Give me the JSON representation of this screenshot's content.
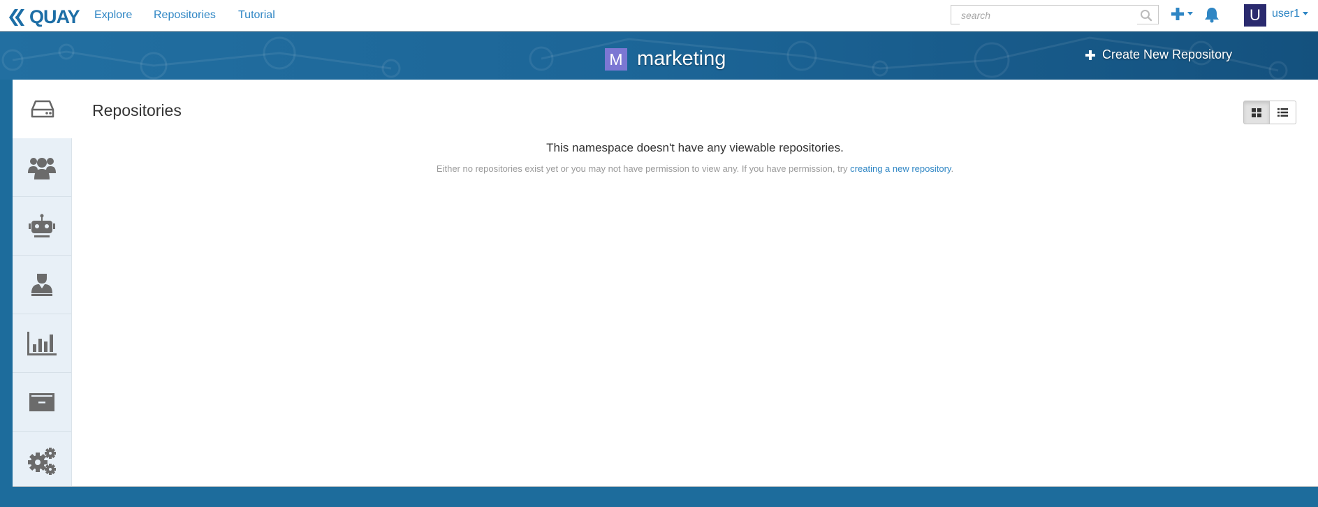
{
  "navbar": {
    "logo_text": "QUAY",
    "links": [
      "Explore",
      "Repositories",
      "Tutorial"
    ],
    "search_placeholder": "search",
    "avatar_letter": "U",
    "username": "user1"
  },
  "banner": {
    "namespace_avatar_letter": "M",
    "namespace_name": "marketing",
    "create_repo_label": "Create New Repository"
  },
  "sidebar": {
    "tabs": [
      {
        "icon": "hdd-icon"
      },
      {
        "icon": "users-icon"
      },
      {
        "icon": "robot-icon"
      },
      {
        "icon": "user-admin-icon"
      },
      {
        "icon": "bar-chart-icon"
      },
      {
        "icon": "archive-icon"
      },
      {
        "icon": "gears-icon"
      }
    ]
  },
  "main": {
    "section_title": "Repositories",
    "empty_title": "This namespace doesn't have any viewable repositories.",
    "empty_text_before": "Either no repositories exist yet or you may not have permission to view any. If you have permission, try ",
    "empty_link": "creating a new repository",
    "empty_text_after": "."
  },
  "colors": {
    "brand": "#1d6ea6",
    "link": "#2f86c4",
    "banner": "#1d6c9c",
    "namespace_avatar": "#7b77d3",
    "user_avatar": "#2a2a6e"
  }
}
